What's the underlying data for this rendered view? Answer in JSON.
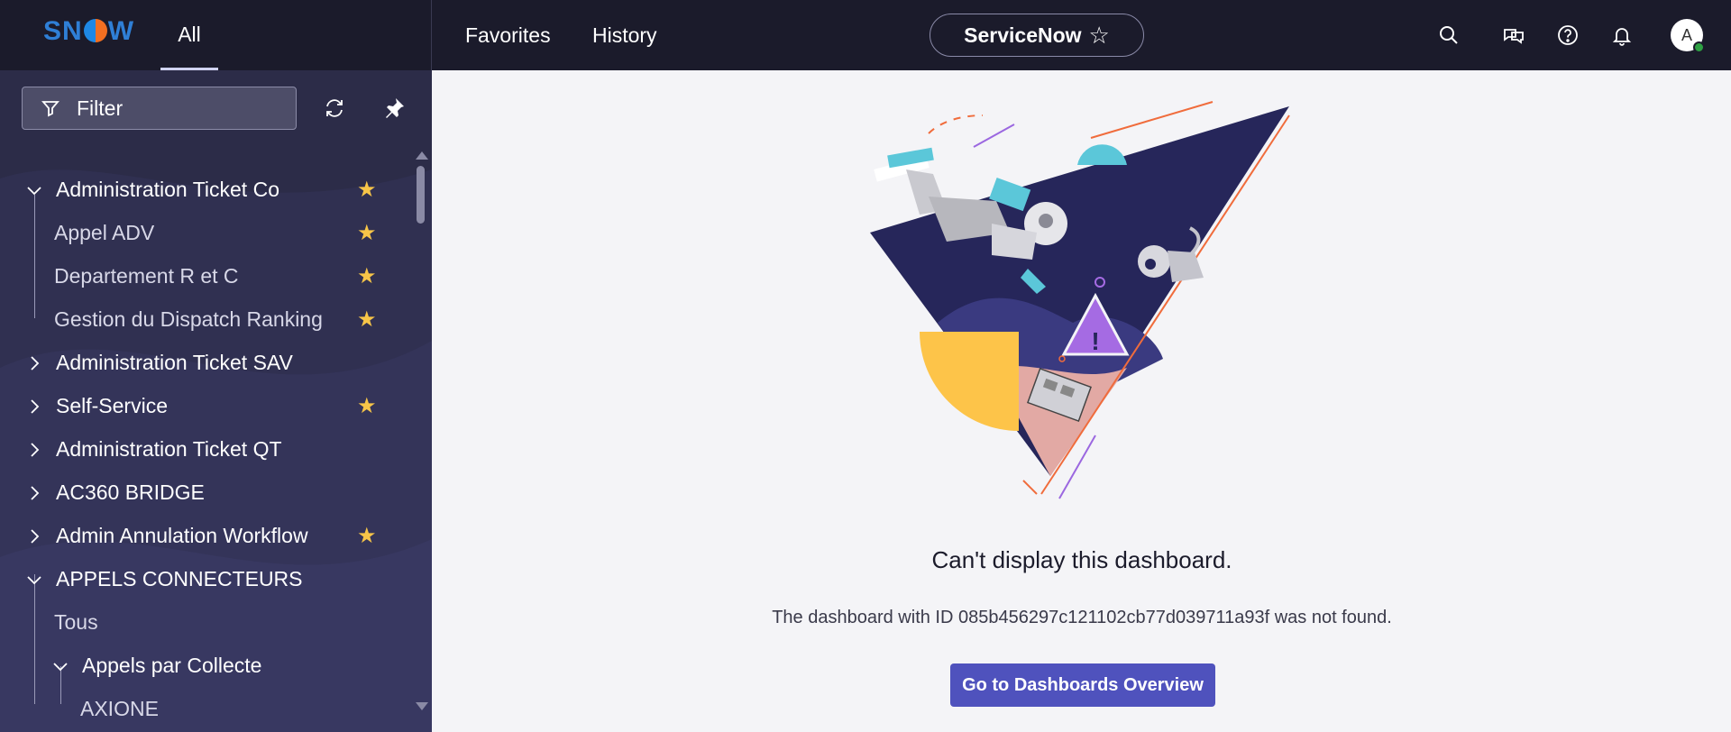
{
  "header": {
    "logo": "SNOW",
    "all_tab": "All",
    "favorites": "Favorites",
    "history": "History",
    "instance": "ServiceNow",
    "avatar_initial": "A",
    "icons": [
      "search-icon",
      "chat-icon",
      "help-icon",
      "bell-icon"
    ]
  },
  "sidebar": {
    "filter_label": "Filter",
    "items": [
      {
        "label": "Administration Ticket Co",
        "expanded": true,
        "favorite": true,
        "level": 0
      },
      {
        "label": "Appel ADV",
        "favorite": true,
        "level": 1
      },
      {
        "label": "Departement R et C",
        "favorite": true,
        "level": 1
      },
      {
        "label": "Gestion du Dispatch Ranking",
        "favorite": true,
        "level": 1
      },
      {
        "label": "Administration Ticket SAV",
        "expanded": false,
        "favorite": false,
        "level": 0
      },
      {
        "label": "Self-Service",
        "expanded": false,
        "favorite": true,
        "level": 0
      },
      {
        "label": "Administration Ticket QT",
        "expanded": false,
        "favorite": false,
        "level": 0
      },
      {
        "label": "AC360 BRIDGE",
        "expanded": false,
        "favorite": false,
        "level": 0
      },
      {
        "label": "Admin Annulation Workflow",
        "expanded": false,
        "favorite": true,
        "level": 0
      },
      {
        "label": "APPELS CONNECTEURS",
        "expanded": true,
        "favorite": false,
        "level": 0
      },
      {
        "label": "Tous",
        "favorite": false,
        "level": 1
      },
      {
        "label": "Appels par Collecte",
        "expanded": true,
        "favorite": false,
        "level": 1
      },
      {
        "label": "AXIONE",
        "favorite": false,
        "level": 2
      }
    ]
  },
  "main": {
    "title": "Can't display this dashboard.",
    "message": "The dashboard with ID 085b456297c121102cb77d039711a93f was not found.",
    "button": "Go to Dashboards Overview"
  },
  "colors": {
    "header_bg": "#1b1b2b",
    "sidebar_bg": "#2c2c48",
    "accent": "#4f52bd",
    "favorite": "#f7c548"
  }
}
